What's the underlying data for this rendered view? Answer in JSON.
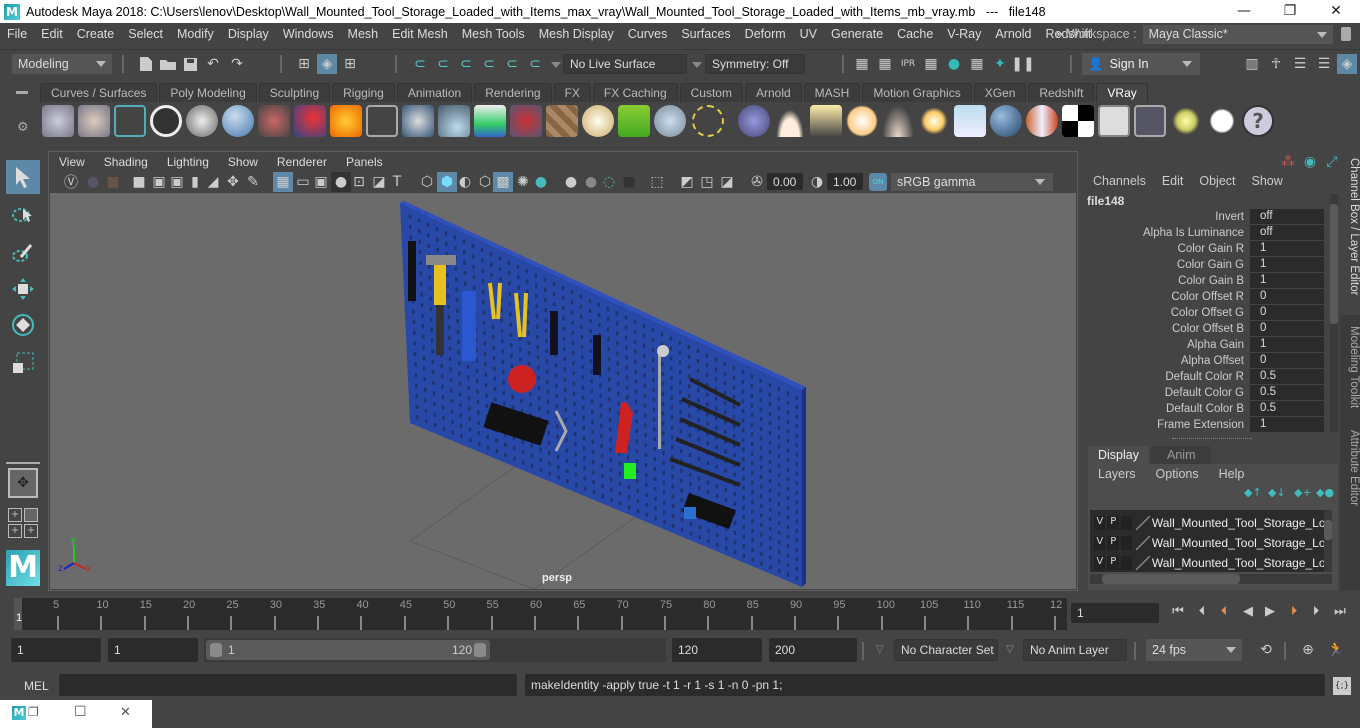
{
  "window": {
    "title": "Autodesk Maya 2018: C:\\Users\\lenov\\Desktop\\Wall_Mounted_Tool_Storage_Loaded_with_Items_max_vray\\Wall_Mounted_Tool_Storage_Loaded_with_Items_mb_vray.mb   ---   file148",
    "logo": "M",
    "minimize": "—",
    "restore": "❐",
    "close": "✕"
  },
  "menubar": {
    "items": [
      "File",
      "Edit",
      "Create",
      "Select",
      "Modify",
      "Display",
      "Windows",
      "Mesh",
      "Edit Mesh",
      "Mesh Tools",
      "Mesh Display",
      "Curves",
      "Surfaces",
      "Deform",
      "UV",
      "Generate",
      "Cache",
      "V-Ray",
      "Arnold",
      "Redshift"
    ],
    "overflow": "»",
    "workspace_label": "Workspace :",
    "workspace_value": "Maya Classic*"
  },
  "statusline": {
    "mode": "Modeling",
    "live_surface": "No Live Surface",
    "symmetry": "Symmetry: Off",
    "sign_in": "Sign In"
  },
  "shelf": {
    "tabs": [
      "Curves / Surfaces",
      "Poly Modeling",
      "Sculpting",
      "Rigging",
      "Animation",
      "Rendering",
      "FX",
      "FX Caching",
      "Custom",
      "Arnold",
      "MASH",
      "Motion Graphics",
      "XGen",
      "Redshift",
      "VRay"
    ],
    "active_tab": "VRay",
    "icons": [
      "save-vrscene-icon",
      "open-vrscene-icon",
      "vray-settings-icon",
      "vray-logo-icon",
      "vray-log-icon",
      "dome-light-icon",
      "camera-icon",
      "spheres-icon",
      "fire-icon",
      "mesh-light-icon",
      "rect-light-icon",
      "proxy-icon",
      "light-heatmap-icon",
      "object-properties-icon",
      "texture-icon",
      "sphere-grid-icon",
      "fur-icon",
      "displacement-icon",
      "curve-icon",
      "sphere-light-icon",
      "dome-half-icon",
      "spot-light-icon",
      "omni-light-icon",
      "ies-light-icon",
      "sun-icon",
      "plane-icon",
      "material-sphere-icon",
      "mtl-wrapper-icon",
      "checker-icon",
      "frame-buffer-icon",
      "render-settings-icon",
      "light-lister-icon",
      "cloud-icon",
      "help-icon"
    ]
  },
  "viewport": {
    "menu": [
      "View",
      "Shading",
      "Lighting",
      "Show",
      "Renderer",
      "Panels"
    ],
    "exposure": "0.00",
    "gamma": "1.00",
    "color_space": "sRGB gamma",
    "camera_label": "persp",
    "axis": {
      "x": "x",
      "y": "y",
      "z": "z"
    }
  },
  "channel_box": {
    "menu": [
      "Channels",
      "Edit",
      "Object",
      "Show"
    ],
    "node": "file148",
    "attributes": [
      {
        "label": "Invert",
        "value": "off"
      },
      {
        "label": "Alpha Is Luminance",
        "value": "off"
      },
      {
        "label": "Color Gain R",
        "value": "1"
      },
      {
        "label": "Color Gain G",
        "value": "1"
      },
      {
        "label": "Color Gain B",
        "value": "1"
      },
      {
        "label": "Color Offset R",
        "value": "0"
      },
      {
        "label": "Color Offset G",
        "value": "0"
      },
      {
        "label": "Color Offset B",
        "value": "0"
      },
      {
        "label": "Alpha Gain",
        "value": "1"
      },
      {
        "label": "Alpha Offset",
        "value": "0"
      },
      {
        "label": "Default Color R",
        "value": "0.5"
      },
      {
        "label": "Default Color G",
        "value": "0.5"
      },
      {
        "label": "Default Color B",
        "value": "0.5"
      },
      {
        "label": "Frame Extension",
        "value": "1"
      }
    ]
  },
  "layer_editor": {
    "tabs": [
      "Display",
      "Anim"
    ],
    "active_tab": "Display",
    "menu": [
      "Layers",
      "Options",
      "Help"
    ],
    "layers": [
      {
        "v": "V",
        "p": "P",
        "name": "Wall_Mounted_Tool_Storage_Loac"
      },
      {
        "v": "V",
        "p": "P",
        "name": "Wall_Mounted_Tool_Storage_Loac"
      },
      {
        "v": "V",
        "p": "P",
        "name": "Wall_Mounted_Tool_Storage_Loac"
      }
    ]
  },
  "side_tabs": [
    "Channel Box / Layer Editor",
    "Modeling Toolkit",
    "Attribute Editor"
  ],
  "timeline": {
    "ticks": [
      "5",
      "10",
      "15",
      "20",
      "25",
      "30",
      "35",
      "40",
      "45",
      "50",
      "55",
      "60",
      "65",
      "70",
      "75",
      "80",
      "85",
      "90",
      "95",
      "100",
      "105",
      "110",
      "115",
      "12"
    ],
    "current_frame_marker": "1",
    "current_frame": "1"
  },
  "range": {
    "start": "1",
    "playback_start": "1",
    "slider_start": "1",
    "slider_end": "120",
    "playback_end": "120",
    "end": "200",
    "character_set": "No Character Set",
    "anim_layer": "No Anim Layer",
    "fps": "24 fps"
  },
  "command_line": {
    "language": "MEL",
    "input": "",
    "result": "makeIdentity -apply true -t 1 -r 1 -s 1 -n 0 -pn 1;"
  },
  "minimized_window": {
    "logo": "M",
    "restore": "❐",
    "maximize": "☐",
    "close": "✕"
  }
}
